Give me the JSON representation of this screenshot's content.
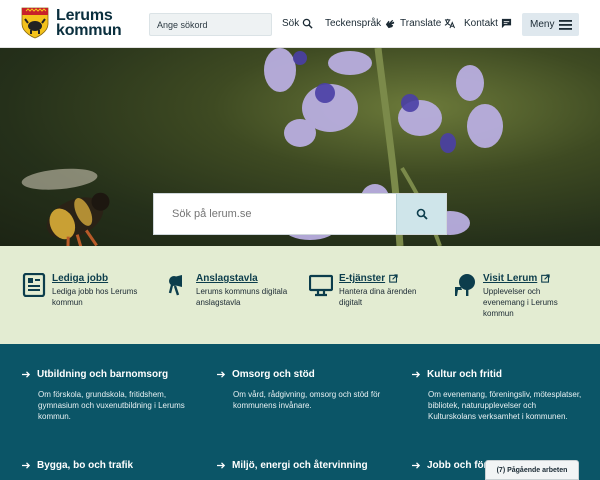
{
  "header": {
    "logo_line1": "Lerums",
    "logo_line2": "kommun",
    "search_placeholder": "Ange sökord",
    "nav": {
      "search": "Sök",
      "sign_language": "Teckenspråk",
      "translate": "Translate",
      "contact": "Kontakt"
    },
    "menu_label": "Meny"
  },
  "hero": {
    "search_placeholder": "Sök på lerum.se"
  },
  "quick_links": [
    {
      "title": "Lediga jobb",
      "desc": "Lediga jobb hos Lerums kommun",
      "external": false
    },
    {
      "title": "Anslagstavla",
      "desc": "Lerums kommuns digitala anslagstavla",
      "external": false
    },
    {
      "title": "E-tjänster",
      "desc": "Hantera dina ärenden digitalt",
      "external": true
    },
    {
      "title": "Visit Lerum",
      "desc": "Upplevelser och evenemang i Lerums kommun",
      "external": true
    }
  ],
  "categories": [
    {
      "title": "Utbildning och barnomsorg",
      "desc": "Om förskola, grundskola, fritidshem, gymnasium och vuxenutbildning i Lerums kommun."
    },
    {
      "title": "Omsorg och stöd",
      "desc": "Om vård, rådgivning, omsorg och stöd för kommunens invånare."
    },
    {
      "title": "Kultur och fritid",
      "desc": "Om evenemang, föreningsliv, mötesplatser, bibliotek, naturupplevelser och Kulturskolans verksamhet i kommunen."
    },
    {
      "title": "Bygga, bo och trafik",
      "desc": ""
    },
    {
      "title": "Miljö, energi och återvinning",
      "desc": ""
    },
    {
      "title": "Jobb och före",
      "desc": ""
    }
  ],
  "ongoing_badge": "(7) Pågående arbeten",
  "colors": {
    "category_bg": "#0b5567",
    "quick_bg": "#e3ecd2",
    "link_color": "#0c3d4c"
  }
}
